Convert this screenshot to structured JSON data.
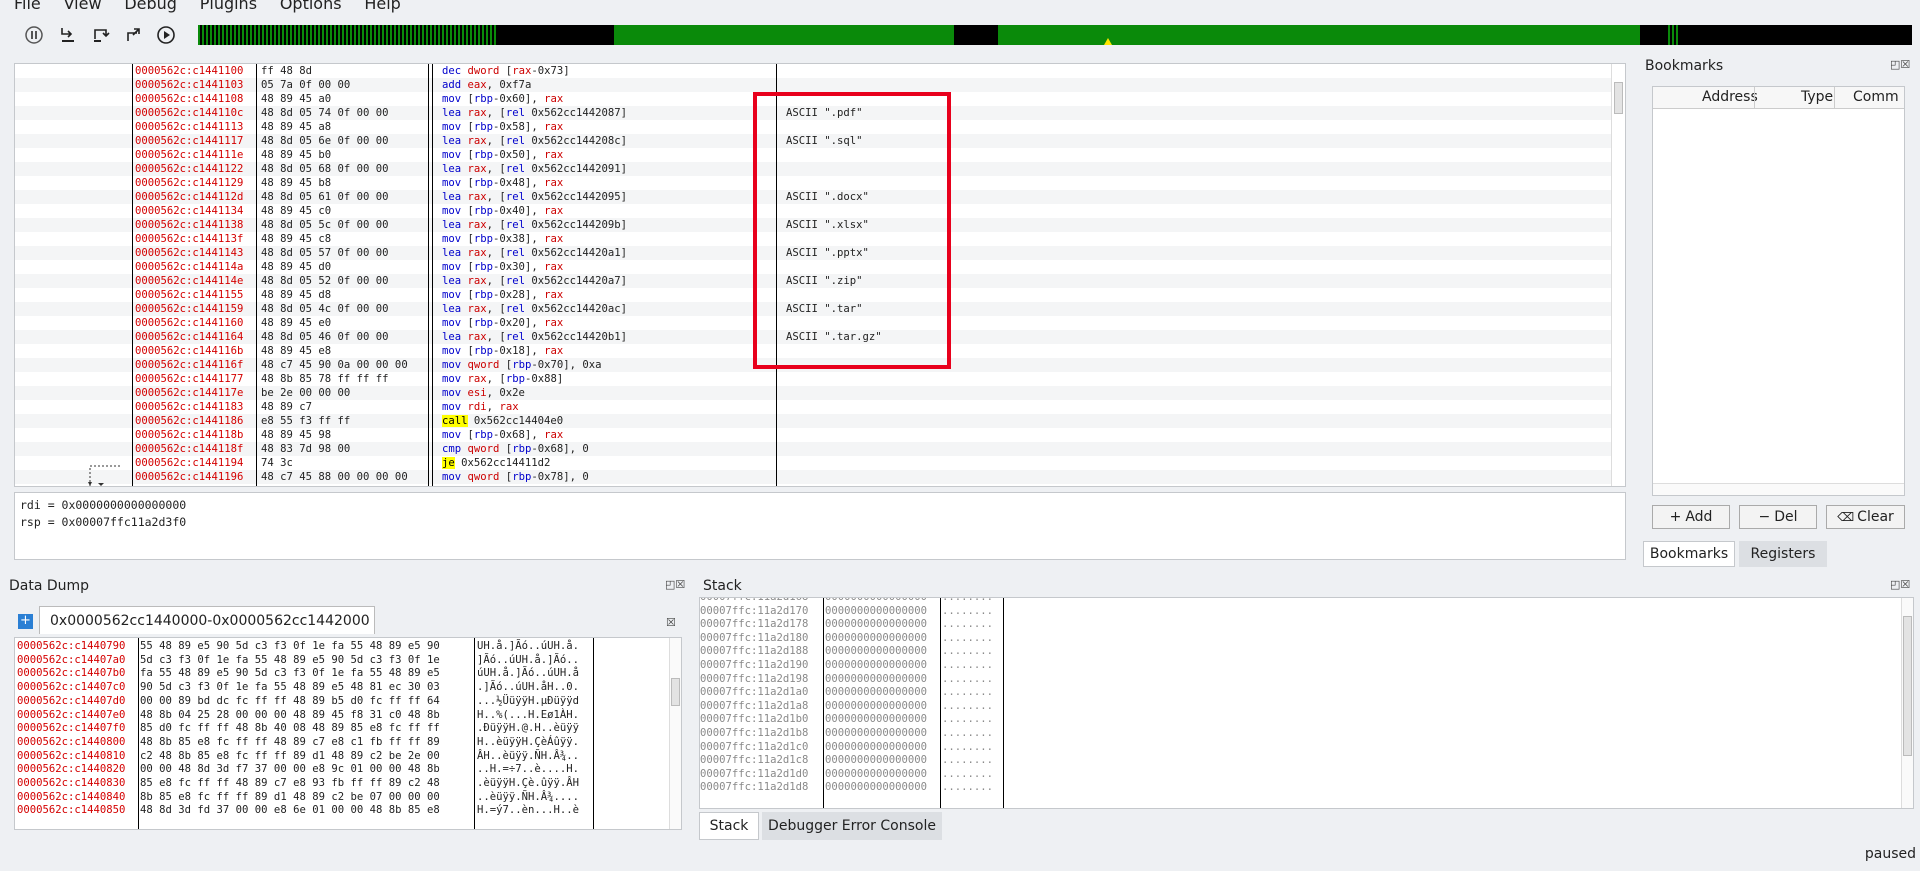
{
  "menu": [
    "File",
    "View",
    "Debug",
    "Plugins",
    "Options",
    "Help"
  ],
  "toolbar": {
    "icons": [
      "pause-icon",
      "step-into-icon",
      "step-over-icon",
      "step-out-icon",
      "run-icon"
    ],
    "colors": {
      "timeline_green": "#0a8a0a",
      "timeline_marker": "#ffe600"
    }
  },
  "disasm": {
    "rows": [
      {
        "addr": "0000562c:c1441100",
        "bytes": "ff 48 8d",
        "mn": "dec",
        "ops": " dword [rax-0x73]",
        "comment": ""
      },
      {
        "addr": "0000562c:c1441103",
        "bytes": "05 7a 0f 00 00",
        "mn": "add",
        "ops": " eax, 0xf7a",
        "comment": ""
      },
      {
        "addr": "0000562c:c1441108",
        "bytes": "48 89 45 a0",
        "mn": "mov",
        "ops": " [rbp-0x60], rax",
        "comment": ""
      },
      {
        "addr": "0000562c:c144110c",
        "bytes": "48 8d 05 74 0f 00 00",
        "mn": "lea",
        "ops": " rax, [rel 0x562cc1442087]",
        "comment": "ASCII \".pdf\""
      },
      {
        "addr": "0000562c:c1441113",
        "bytes": "48 89 45 a8",
        "mn": "mov",
        "ops": " [rbp-0x58], rax",
        "comment": ""
      },
      {
        "addr": "0000562c:c1441117",
        "bytes": "48 8d 05 6e 0f 00 00",
        "mn": "lea",
        "ops": " rax, [rel 0x562cc144208c]",
        "comment": "ASCII \".sql\""
      },
      {
        "addr": "0000562c:c144111e",
        "bytes": "48 89 45 b0",
        "mn": "mov",
        "ops": " [rbp-0x50], rax",
        "comment": ""
      },
      {
        "addr": "0000562c:c1441122",
        "bytes": "48 8d 05 68 0f 00 00",
        "mn": "lea",
        "ops": " rax, [rel 0x562cc1442091]",
        "comment": ""
      },
      {
        "addr": "0000562c:c1441129",
        "bytes": "48 89 45 b8",
        "mn": "mov",
        "ops": " [rbp-0x48], rax",
        "comment": ""
      },
      {
        "addr": "0000562c:c144112d",
        "bytes": "48 8d 05 61 0f 00 00",
        "mn": "lea",
        "ops": " rax, [rel 0x562cc1442095]",
        "comment": "ASCII \".docx\""
      },
      {
        "addr": "0000562c:c1441134",
        "bytes": "48 89 45 c0",
        "mn": "mov",
        "ops": " [rbp-0x40], rax",
        "comment": ""
      },
      {
        "addr": "0000562c:c1441138",
        "bytes": "48 8d 05 5c 0f 00 00",
        "mn": "lea",
        "ops": " rax, [rel 0x562cc144209b]",
        "comment": "ASCII \".xlsx\""
      },
      {
        "addr": "0000562c:c144113f",
        "bytes": "48 89 45 c8",
        "mn": "mov",
        "ops": " [rbp-0x38], rax",
        "comment": ""
      },
      {
        "addr": "0000562c:c1441143",
        "bytes": "48 8d 05 57 0f 00 00",
        "mn": "lea",
        "ops": " rax, [rel 0x562cc14420a1]",
        "comment": "ASCII \".pptx\""
      },
      {
        "addr": "0000562c:c144114a",
        "bytes": "48 89 45 d0",
        "mn": "mov",
        "ops": " [rbp-0x30], rax",
        "comment": ""
      },
      {
        "addr": "0000562c:c144114e",
        "bytes": "48 8d 05 52 0f 00 00",
        "mn": "lea",
        "ops": " rax, [rel 0x562cc14420a7]",
        "comment": "ASCII \".zip\""
      },
      {
        "addr": "0000562c:c1441155",
        "bytes": "48 89 45 d8",
        "mn": "mov",
        "ops": " [rbp-0x28], rax",
        "comment": ""
      },
      {
        "addr": "0000562c:c1441159",
        "bytes": "48 8d 05 4c 0f 00 00",
        "mn": "lea",
        "ops": " rax, [rel 0x562cc14420ac]",
        "comment": "ASCII \".tar\""
      },
      {
        "addr": "0000562c:c1441160",
        "bytes": "48 89 45 e0",
        "mn": "mov",
        "ops": " [rbp-0x20], rax",
        "comment": ""
      },
      {
        "addr": "0000562c:c1441164",
        "bytes": "48 8d 05 46 0f 00 00",
        "mn": "lea",
        "ops": " rax, [rel 0x562cc14420b1]",
        "comment": "ASCII \".tar.gz\""
      },
      {
        "addr": "0000562c:c144116b",
        "bytes": "48 89 45 e8",
        "mn": "mov",
        "ops": " [rbp-0x18], rax",
        "comment": ""
      },
      {
        "addr": "0000562c:c144116f",
        "bytes": "48 c7 45 90 0a 00 00 00",
        "mn": "mov",
        "ops": " qword [rbp-0x70], 0xa",
        "comment": ""
      },
      {
        "addr": "0000562c:c1441177",
        "bytes": "48 8b 85 78 ff ff ff",
        "mn": "mov",
        "ops": " rax, [rbp-0x88]",
        "comment": ""
      },
      {
        "addr": "0000562c:c144117e",
        "bytes": "be 2e 00 00 00",
        "mn": "mov",
        "ops": " esi, 0x2e",
        "comment": ""
      },
      {
        "addr": "0000562c:c1441183",
        "bytes": "48 89 c7",
        "mn": "mov",
        "ops": " rdi, rax",
        "comment": ""
      },
      {
        "addr": "0000562c:c1441186",
        "bytes": "e8 55 f3 ff ff",
        "mn": "call",
        "ops": " 0x562cc14404e0",
        "comment": "",
        "hl": true
      },
      {
        "addr": "0000562c:c144118b",
        "bytes": "48 89 45 98",
        "mn": "mov",
        "ops": " [rbp-0x68], rax",
        "comment": ""
      },
      {
        "addr": "0000562c:c144118f",
        "bytes": "48 83 7d 98 00",
        "mn": "cmp",
        "ops": " qword [rbp-0x68], 0",
        "comment": ""
      },
      {
        "addr": "0000562c:c1441194",
        "bytes": "74 3c",
        "mn": "je",
        "ops": " 0x562cc14411d2",
        "comment": "",
        "hl": true
      },
      {
        "addr": "0000562c:c1441196",
        "bytes": "48 c7 45 88 00 00 00 00",
        "mn": "mov",
        "ops": " qword [rbp-0x78], 0",
        "comment": ""
      }
    ]
  },
  "registers": {
    "line1": "rdi = 0x0000000000000000",
    "line2": "rsp = 0x00007ffc11a2d3f0"
  },
  "bookmarks": {
    "title": "Bookmarks",
    "columns": [
      "Address",
      "Type",
      "Comm"
    ],
    "add_label": "Add",
    "del_label": "Del",
    "clear_label": "Clear",
    "tabs": [
      "Bookmarks",
      "Registers"
    ]
  },
  "dump": {
    "title": "Data Dump",
    "tab_label": "0x0000562cc1440000-0x0000562cc1442000",
    "rows": [
      {
        "addr": "0000562c:c1440790",
        "hex": "55 48 89 e5 90 5d c3 f3 0f 1e fa 55 48 89 e5 90",
        "ascii": "UH.å.]Ãó..úUH.å."
      },
      {
        "addr": "0000562c:c14407a0",
        "hex": "5d c3 f3 0f 1e fa 55 48 89 e5 90 5d c3 f3 0f 1e",
        "ascii": "]Ãó..úUH.å.]Ãó.."
      },
      {
        "addr": "0000562c:c14407b0",
        "hex": "fa 55 48 89 e5 90 5d c3 f3 0f 1e fa 55 48 89 e5",
        "ascii": "úUH.å.]Ãó..úUH.å"
      },
      {
        "addr": "0000562c:c14407c0",
        "hex": "90 5d c3 f3 0f 1e fa 55 48 89 e5 48 81 ec 30 03",
        "ascii": ".]Ãó..úUH.åH..0."
      },
      {
        "addr": "0000562c:c14407d0",
        "hex": "00 00 89 bd dc fc ff ff 48 89 b5 d0 fc ff ff 64",
        "ascii": "...½ÜüÿÿH.µÐüÿÿd"
      },
      {
        "addr": "0000562c:c14407e0",
        "hex": "48 8b 04 25 28 00 00 00 48 89 45 f8 31 c0 48 8b",
        "ascii": "H..%(...H.Eø1ÀH."
      },
      {
        "addr": "0000562c:c14407f0",
        "hex": "85 d0 fc ff ff 48 8b 40 08 48 89 85 e8 fc ff ff",
        "ascii": ".ÐüÿÿH.@.H..èüÿÿ"
      },
      {
        "addr": "0000562c:c1440800",
        "hex": "48 8b 85 e8 fc ff ff 48 89 c7 e8 c1 fb ff ff 89",
        "ascii": "H..èüÿÿH.ÇèÁûÿÿ."
      },
      {
        "addr": "0000562c:c1440810",
        "hex": "c2 48 8b 85 e8 fc ff ff 89 d1 48 89 c2 be 2e 00",
        "ascii": "ÂH..èüÿÿ.ÑH.Â¾.."
      },
      {
        "addr": "0000562c:c1440820",
        "hex": "00 00 48 8d 3d f7 37 00 00 e8 9c 01 00 00 48 8b",
        "ascii": "..H.=÷7..è....H."
      },
      {
        "addr": "0000562c:c1440830",
        "hex": "85 e8 fc ff ff 48 89 c7 e8 93 fb ff ff 89 c2 48",
        "ascii": ".èüÿÿH.Çè.ûÿÿ.ÂH"
      },
      {
        "addr": "0000562c:c1440840",
        "hex": "8b 85 e8 fc ff ff 89 d1 48 89 c2 be 07 00 00 00",
        "ascii": "..èüÿÿ.ÑH.Â¾...."
      },
      {
        "addr": "0000562c:c1440850",
        "hex": "48 8d 3d fd 37 00 00 e8 6e 01 00 00 48 8b 85 e8",
        "ascii": "H.=ý7..èn...H..è"
      }
    ]
  },
  "stack": {
    "title": "Stack",
    "rows": [
      {
        "addr": "00007ffc:11a2d168",
        "val": "0000000000000000",
        "ascii": "........"
      },
      {
        "addr": "00007ffc:11a2d170",
        "val": "0000000000000000",
        "ascii": "........"
      },
      {
        "addr": "00007ffc:11a2d178",
        "val": "0000000000000000",
        "ascii": "........"
      },
      {
        "addr": "00007ffc:11a2d180",
        "val": "0000000000000000",
        "ascii": "........"
      },
      {
        "addr": "00007ffc:11a2d188",
        "val": "0000000000000000",
        "ascii": "........"
      },
      {
        "addr": "00007ffc:11a2d190",
        "val": "0000000000000000",
        "ascii": "........"
      },
      {
        "addr": "00007ffc:11a2d198",
        "val": "0000000000000000",
        "ascii": "........"
      },
      {
        "addr": "00007ffc:11a2d1a0",
        "val": "0000000000000000",
        "ascii": "........"
      },
      {
        "addr": "00007ffc:11a2d1a8",
        "val": "0000000000000000",
        "ascii": "........"
      },
      {
        "addr": "00007ffc:11a2d1b0",
        "val": "0000000000000000",
        "ascii": "........"
      },
      {
        "addr": "00007ffc:11a2d1b8",
        "val": "0000000000000000",
        "ascii": "........"
      },
      {
        "addr": "00007ffc:11a2d1c0",
        "val": "0000000000000000",
        "ascii": "........"
      },
      {
        "addr": "00007ffc:11a2d1c8",
        "val": "0000000000000000",
        "ascii": "........"
      },
      {
        "addr": "00007ffc:11a2d1d0",
        "val": "0000000000000000",
        "ascii": "........"
      },
      {
        "addr": "00007ffc:11a2d1d8",
        "val": "0000000000000000",
        "ascii": "........"
      }
    ]
  },
  "bottom_tabs": [
    "Stack",
    "Debugger Error Console"
  ],
  "status": "paused"
}
